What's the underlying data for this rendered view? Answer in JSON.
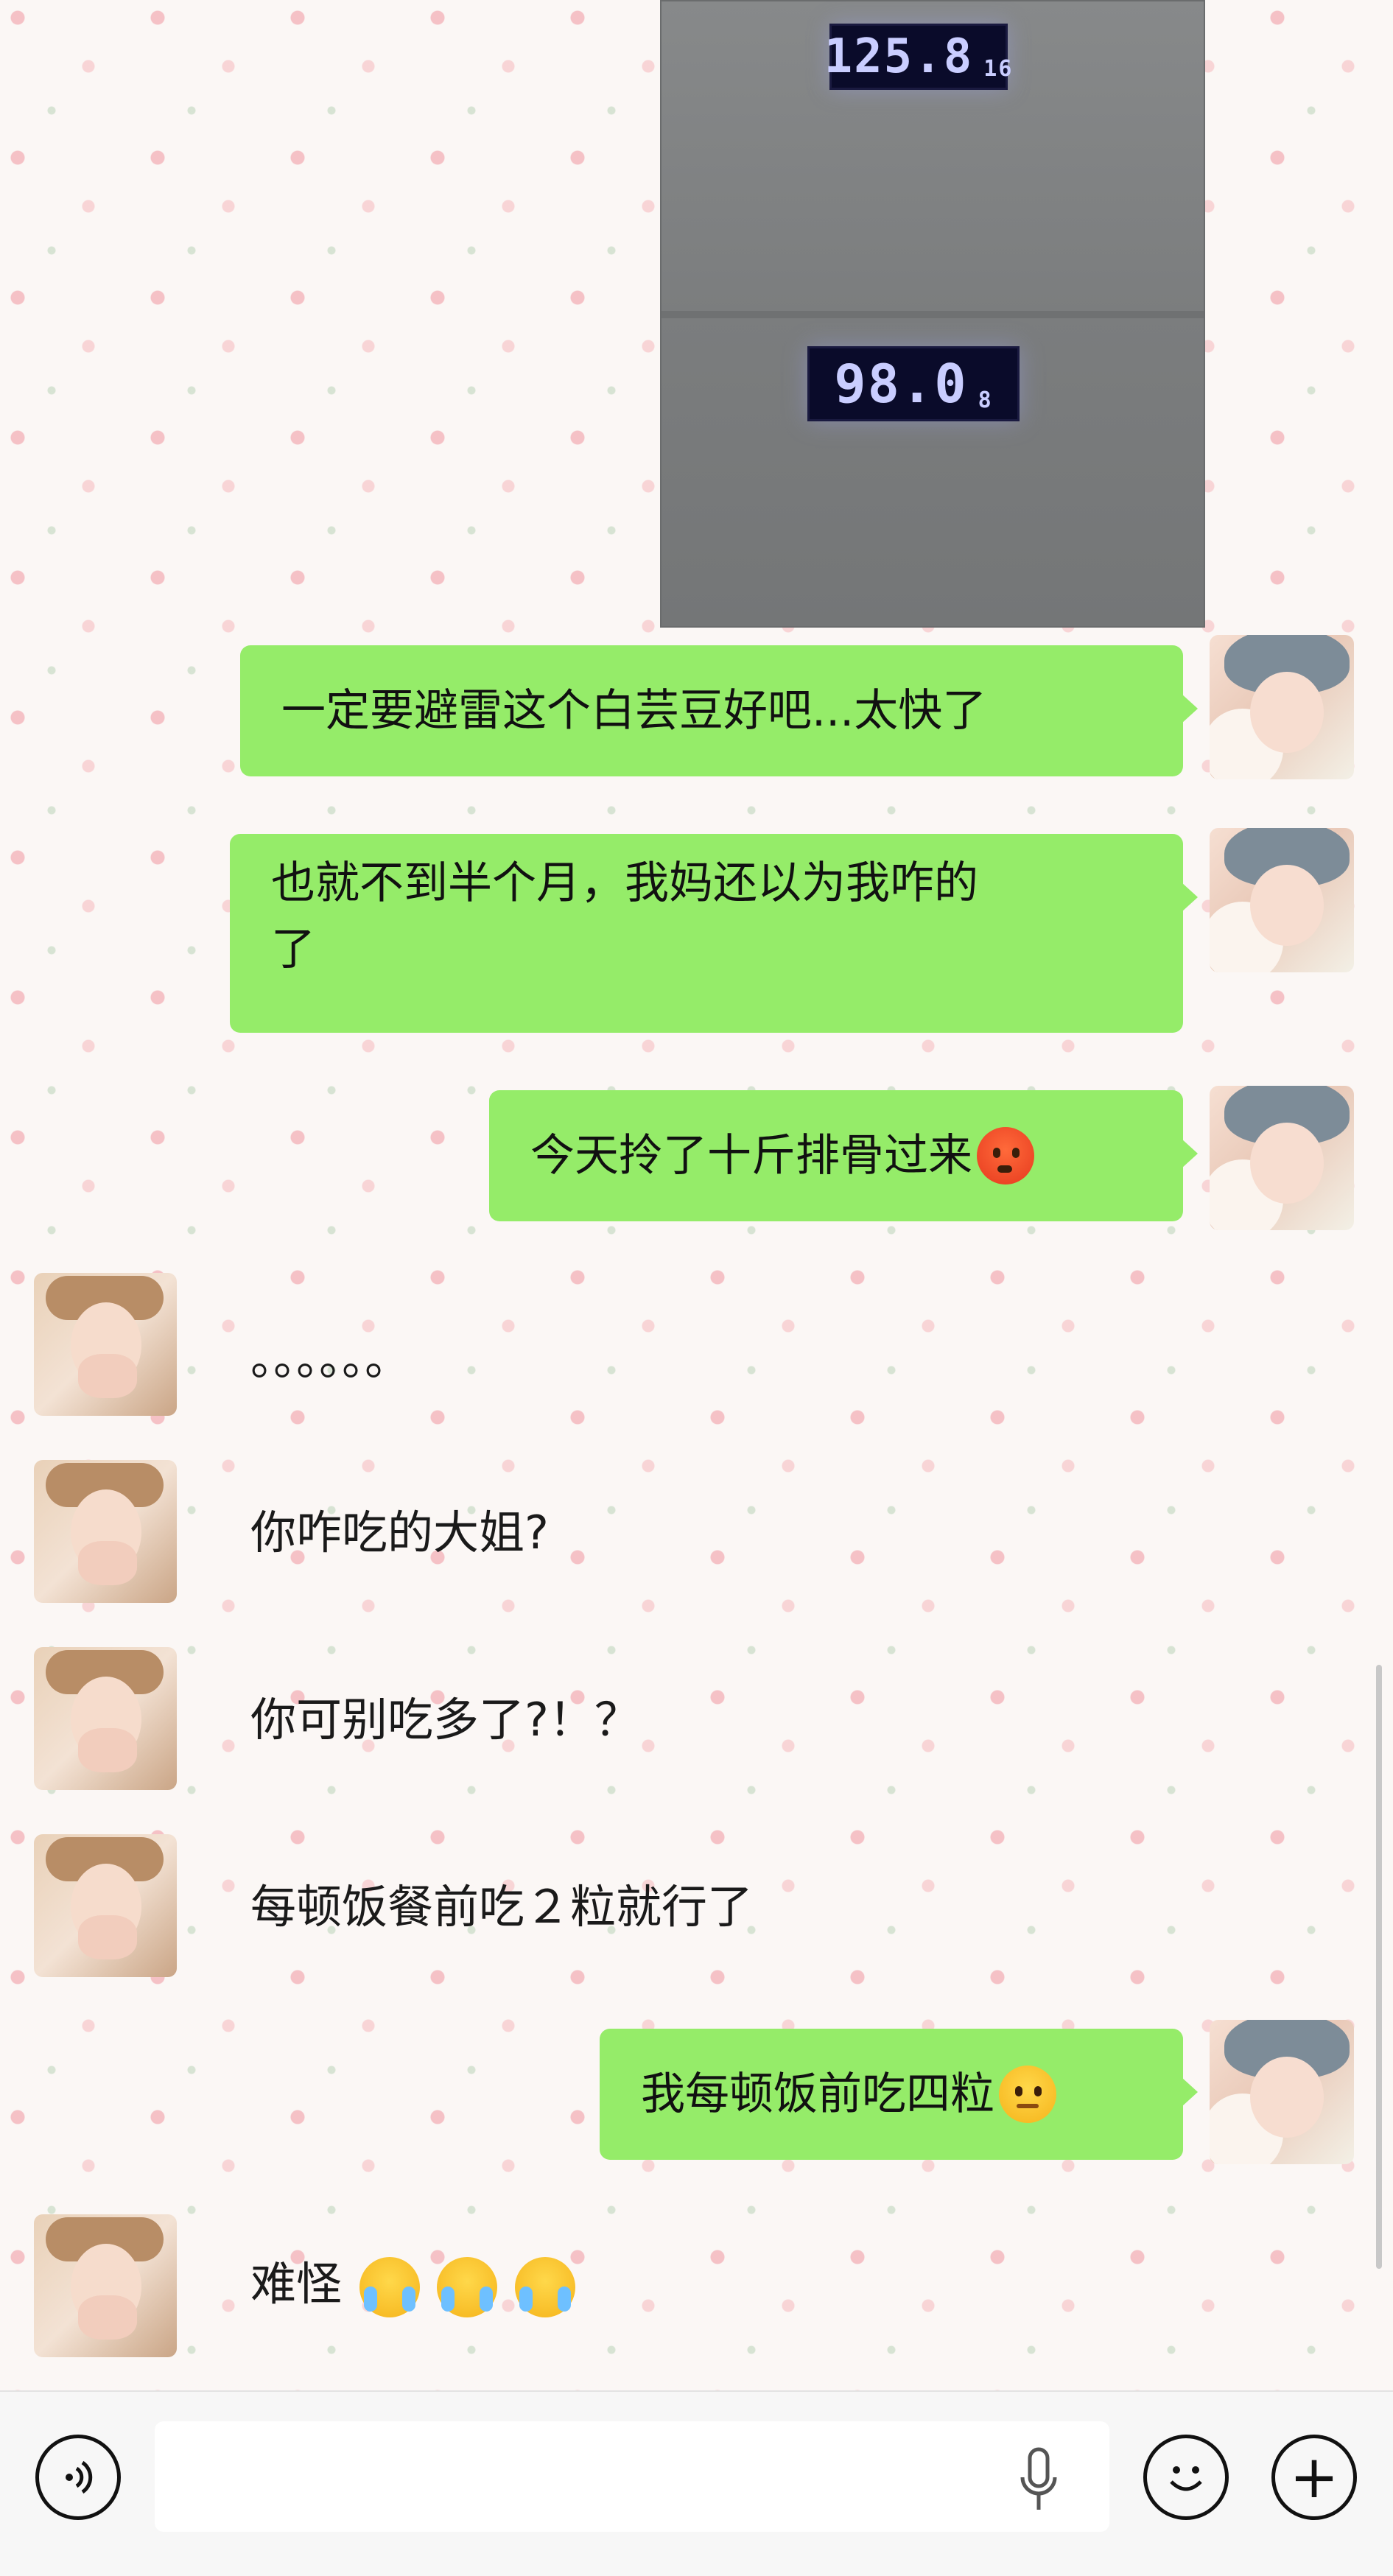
{
  "photo": {
    "top_scale_reading": "125.8",
    "top_scale_small": "16",
    "bottom_scale_reading": "98.0",
    "bottom_scale_small": "8"
  },
  "messages": [
    {
      "side": "right",
      "text": "一定要避雷这个白芸豆好吧...太快了"
    },
    {
      "side": "right",
      "line1": "也就不到半个月，我妈还以为我咋的",
      "line2": "了"
    },
    {
      "side": "right",
      "text": "今天拎了十斤排骨过来",
      "emoji": "hot-face-emoji"
    },
    {
      "side": "left",
      "text": "。。。。。。"
    },
    {
      "side": "left",
      "text": "你咋吃的大姐?"
    },
    {
      "side": "left",
      "text": "你可别吃多了?！？"
    },
    {
      "side": "left",
      "text": "每顿饭餐前吃２粒就行了"
    },
    {
      "side": "right",
      "text": "我每顿饭前吃四粒",
      "emoji": "smirk-emoji"
    },
    {
      "side": "left",
      "text": "难怪",
      "emoji": "crying-face-emoji"
    }
  ],
  "bottom_bar": {
    "voice_icon": "voice-mode-icon",
    "mic_icon": "microphone-icon",
    "emoji_icon": "emoji-icon",
    "plus_label": "+",
    "plus_icon": "plus-icon"
  },
  "colors": {
    "sent_bubble": "#95ec69",
    "background": "#fbf7f5"
  }
}
